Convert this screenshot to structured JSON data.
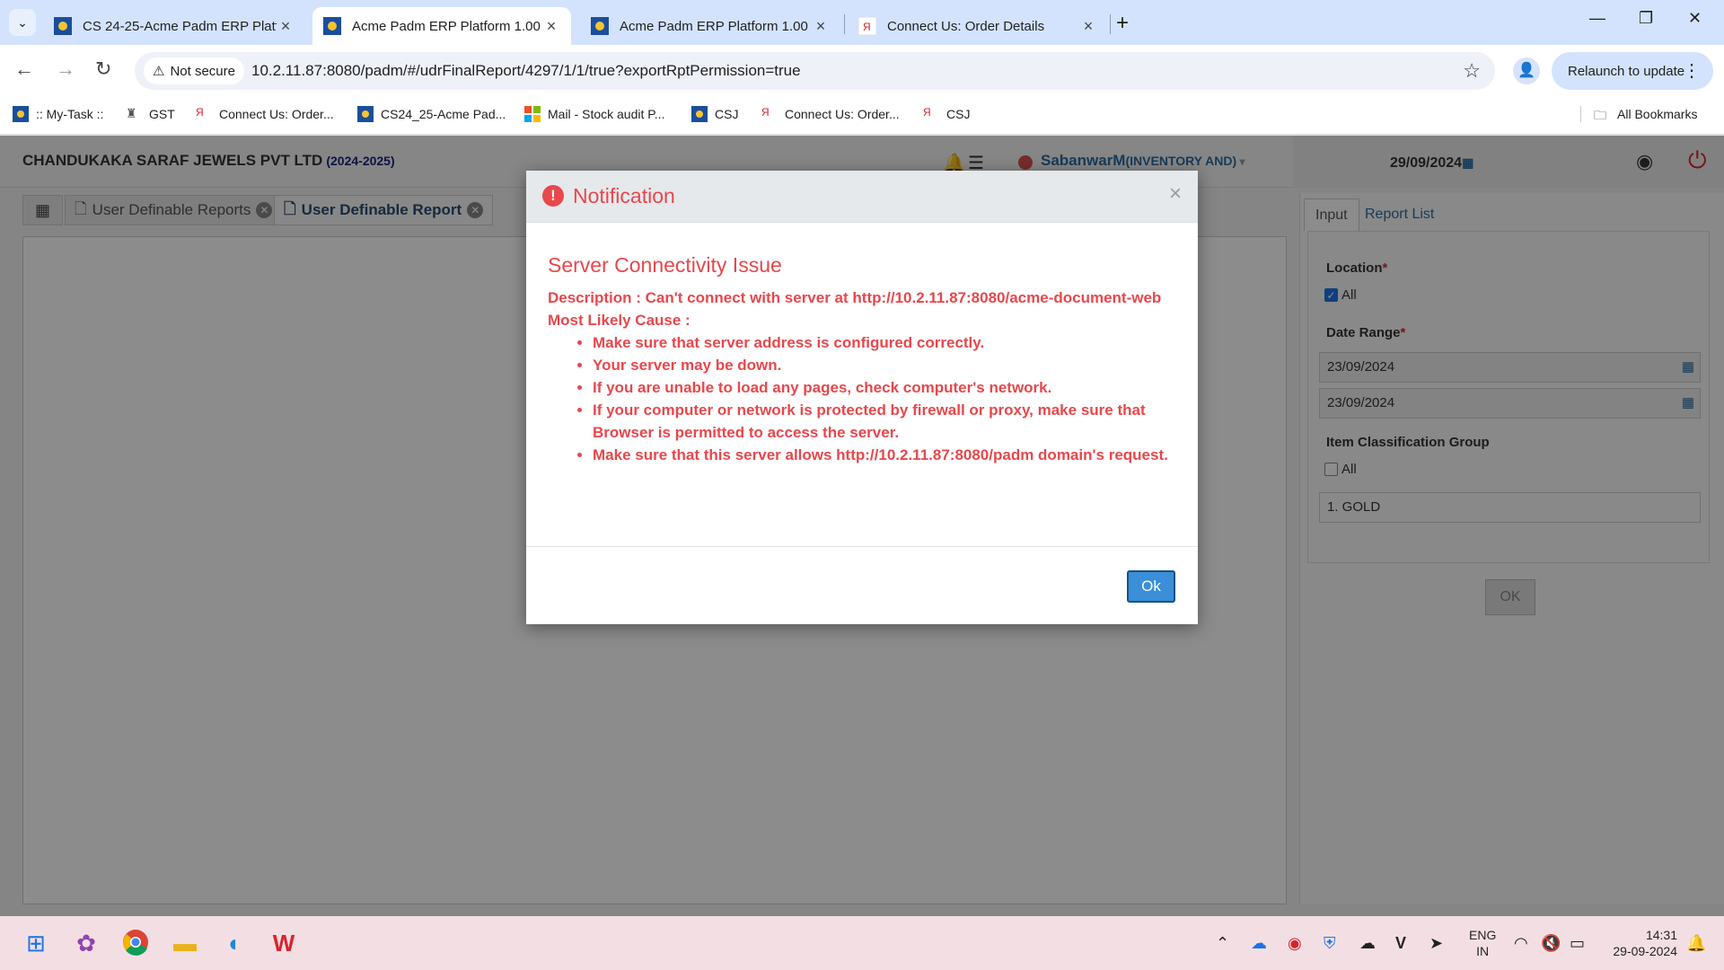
{
  "browser": {
    "tabs": [
      {
        "title": "CS 24-25-Acme Padm ERP Platf",
        "active": false
      },
      {
        "title": "Acme Padm ERP Platform 1.00",
        "active": true
      },
      {
        "title": "Acme Padm ERP Platform 1.00",
        "active": false
      },
      {
        "title": "Connect Us: Order Details",
        "active": false
      }
    ],
    "not_secure": "Not secure",
    "url": "10.2.11.87:8080/padm/#/udrFinalReport/4297/1/1/true?exportRptPermission=true",
    "relaunch": "Relaunch to update",
    "bookmarks": [
      ":: My-Task ::",
      "GST",
      "Connect Us: Order...",
      "CS24_25-Acme Pad...",
      "Mail - Stock audit P...",
      "CSJ",
      "Connect Us: Order...",
      "CSJ"
    ],
    "all_bookmarks": "All Bookmarks"
  },
  "app": {
    "company": "CHANDUKAKA SARAF JEWELS PVT LTD",
    "year": "(2024-2025)",
    "user": "SabanwarM",
    "role": "(INVENTORY AND)",
    "date": "29/09/2024",
    "tabs": [
      {
        "label": "User Definable Reports"
      },
      {
        "label": "User Definable Report"
      }
    ]
  },
  "panel": {
    "tabs": [
      "Input",
      "Report List"
    ],
    "location_label": "Location",
    "location_all": "All",
    "date_range_label": "Date Range",
    "date_from": "23/09/2024",
    "date_to": "23/09/2024",
    "item_group_label": "Item Classification Group",
    "item_group_all": "All",
    "item_group_value": "1. GOLD",
    "ok": "OK"
  },
  "modal": {
    "title": "Notification",
    "issue": "Server Connectivity Issue",
    "description": "Description : Can't connect with server at http://10.2.11.87:8080/acme-document-web",
    "cause_label": "Most Likely Cause :",
    "causes": [
      "Make sure that server address is configured correctly.",
      "Your server may be down.",
      "If you are unable to load any pages, check computer's network.",
      "If your computer or network is protected by firewall or proxy, make sure that Browser is permitted to access the server.",
      "Make sure that this server allows http://10.2.11.87:8080/padm domain's request."
    ],
    "ok": "Ok"
  },
  "taskbar": {
    "lang1": "ENG",
    "lang2": "IN",
    "time": "14:31",
    "date": "29-09-2024"
  },
  "colors": {
    "error": "#e8474c",
    "link": "#2b6ca3",
    "ok_button": "#3a8fd8"
  }
}
